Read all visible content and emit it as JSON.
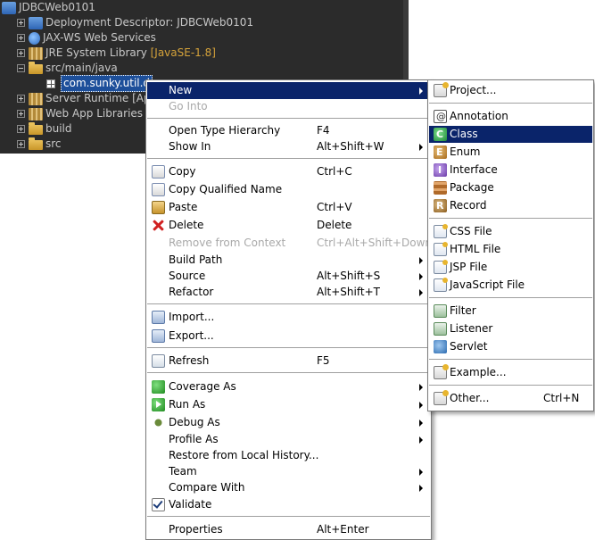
{
  "explorer": {
    "root": "JDBCWeb0101",
    "items": [
      {
        "label": "Deployment Descriptor: JDBCWeb0101",
        "annotation": ""
      },
      {
        "label": "JAX-WS Web Services",
        "annotation": ""
      },
      {
        "label": "JRE System Library ",
        "annotation": "[JavaSE-1.8]"
      },
      {
        "label": "src/main/java",
        "annotation": ""
      },
      {
        "label": "com.sunky.util.d",
        "annotation": ""
      },
      {
        "label": "Server Runtime [Ap",
        "annotation": ""
      },
      {
        "label": "Web App Libraries",
        "annotation": ""
      },
      {
        "label": "build",
        "annotation": ""
      },
      {
        "label": "src",
        "annotation": ""
      }
    ]
  },
  "context_menu": {
    "items": [
      {
        "label": "New",
        "shortcut": ""
      },
      {
        "label": "Go Into",
        "shortcut": ""
      },
      {
        "label": "Open Type Hierarchy",
        "shortcut": "F4"
      },
      {
        "label": "Show In",
        "shortcut": "Alt+Shift+W"
      },
      {
        "label": "Copy",
        "shortcut": "Ctrl+C"
      },
      {
        "label": "Copy Qualified Name",
        "shortcut": ""
      },
      {
        "label": "Paste",
        "shortcut": "Ctrl+V"
      },
      {
        "label": "Delete",
        "shortcut": "Delete"
      },
      {
        "label": "Remove from Context",
        "shortcut": "Ctrl+Alt+Shift+Down"
      },
      {
        "label": "Build Path",
        "shortcut": ""
      },
      {
        "label": "Source",
        "shortcut": "Alt+Shift+S"
      },
      {
        "label": "Refactor",
        "shortcut": "Alt+Shift+T"
      },
      {
        "label": "Import...",
        "shortcut": ""
      },
      {
        "label": "Export...",
        "shortcut": ""
      },
      {
        "label": "Refresh",
        "shortcut": "F5"
      },
      {
        "label": "Coverage As",
        "shortcut": ""
      },
      {
        "label": "Run As",
        "shortcut": ""
      },
      {
        "label": "Debug As",
        "shortcut": ""
      },
      {
        "label": "Profile As",
        "shortcut": ""
      },
      {
        "label": "Restore from Local History...",
        "shortcut": ""
      },
      {
        "label": "Team",
        "shortcut": ""
      },
      {
        "label": "Compare With",
        "shortcut": ""
      },
      {
        "label": "Validate",
        "shortcut": ""
      },
      {
        "label": "Properties",
        "shortcut": "Alt+Enter"
      }
    ]
  },
  "new_submenu": {
    "items": [
      {
        "label": "Project...",
        "shortcut": ""
      },
      {
        "label": "Annotation",
        "shortcut": ""
      },
      {
        "label": "Class",
        "shortcut": ""
      },
      {
        "label": "Enum",
        "shortcut": ""
      },
      {
        "label": "Interface",
        "shortcut": ""
      },
      {
        "label": "Package",
        "shortcut": ""
      },
      {
        "label": "Record",
        "shortcut": ""
      },
      {
        "label": "CSS File",
        "shortcut": ""
      },
      {
        "label": "HTML File",
        "shortcut": ""
      },
      {
        "label": "JSP File",
        "shortcut": ""
      },
      {
        "label": "JavaScript File",
        "shortcut": ""
      },
      {
        "label": "Filter",
        "shortcut": ""
      },
      {
        "label": "Listener",
        "shortcut": ""
      },
      {
        "label": "Servlet",
        "shortcut": ""
      },
      {
        "label": "Example...",
        "shortcut": ""
      },
      {
        "label": "Other...",
        "shortcut": "Ctrl+N"
      }
    ]
  },
  "colors": {
    "explorer_bg": "#2b2b2b",
    "highlight": "#0a246a",
    "disabled": "#a9a9a9",
    "annotation": "#d4a23a"
  }
}
